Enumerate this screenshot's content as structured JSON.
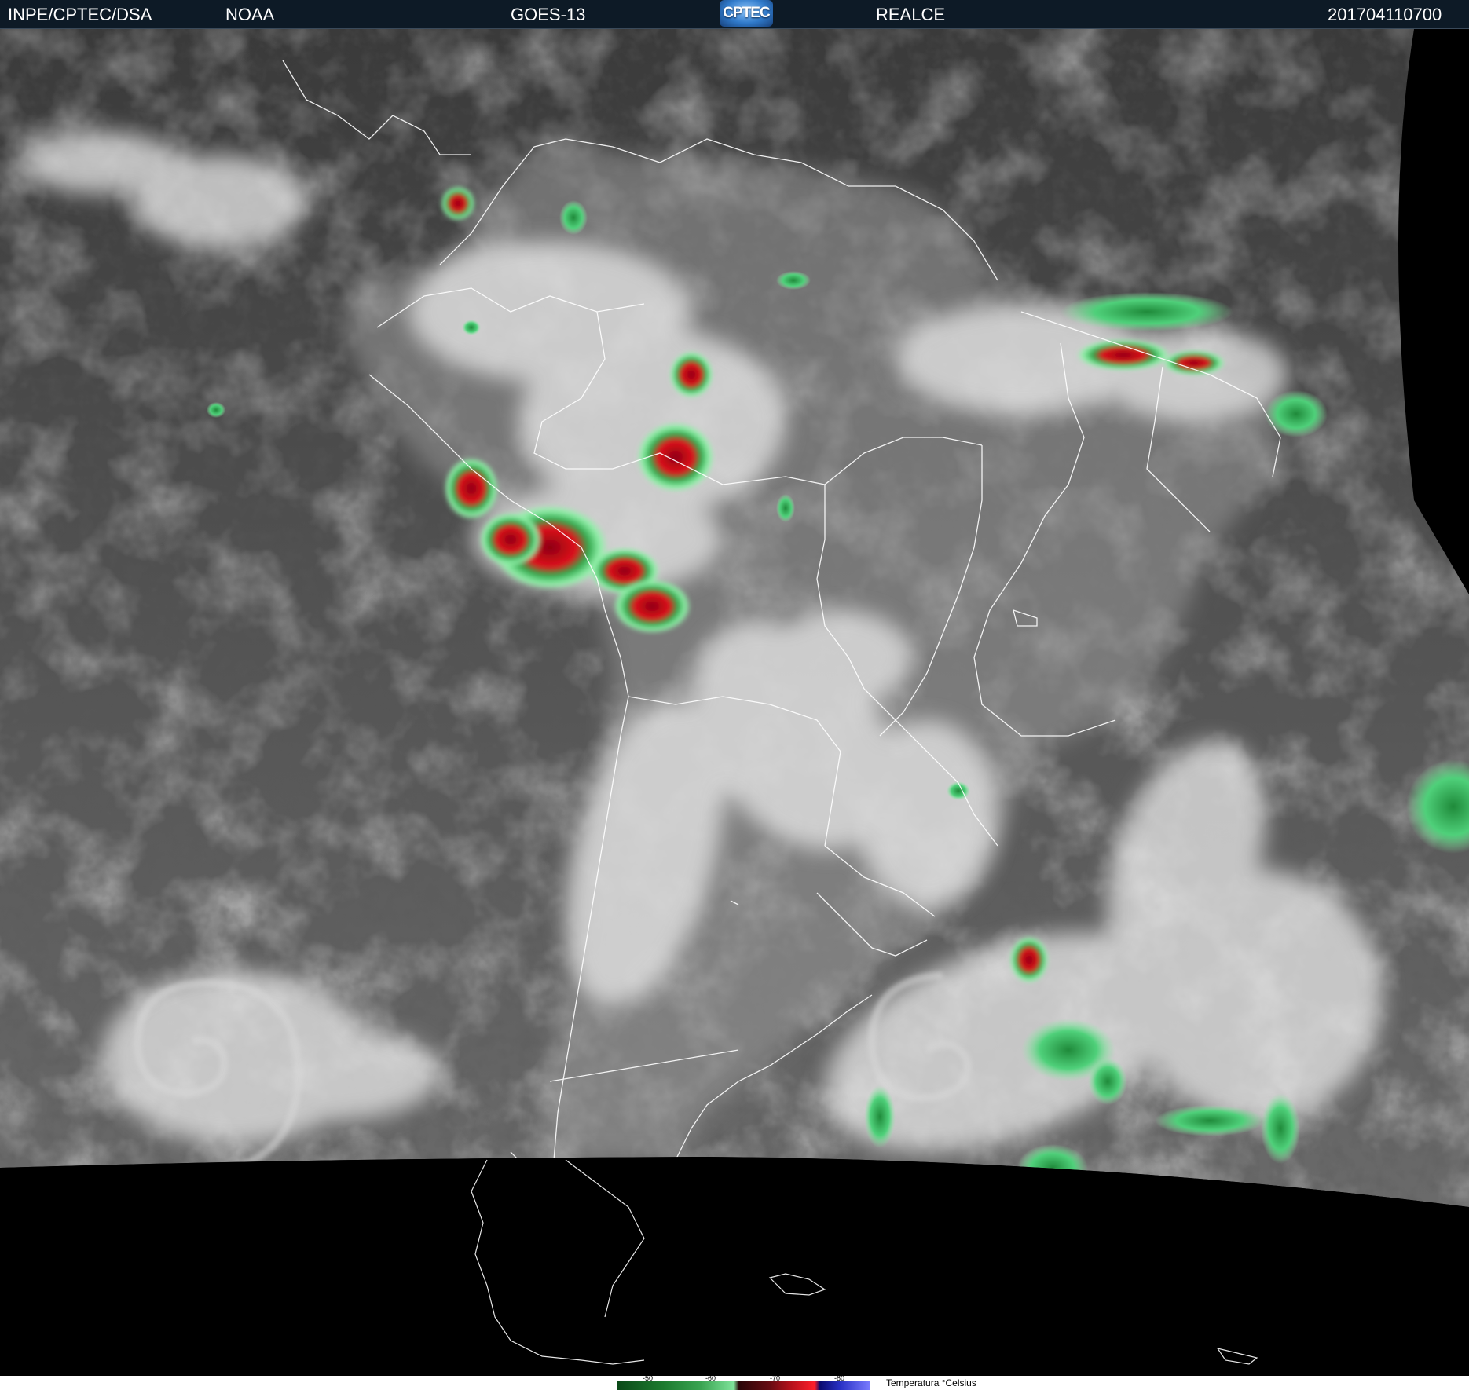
{
  "header": {
    "org": "INPE/CPTEC/DSA",
    "agency": "NOAA",
    "satellite": "GOES-13",
    "logo_text": "CPTEC",
    "product": "REALCE",
    "timestamp": "201704110700"
  },
  "legend": {
    "ticks": [
      "-50",
      "-60",
      "-70",
      "-80"
    ],
    "title": "Temperatura °Celsius"
  },
  "colors": {
    "header_bg": "#0d1a26",
    "space": "#000000",
    "ocean_gray": "#5a5a5a",
    "cloud_white": "#e6e6e6",
    "cold_green": "#3fcf6a",
    "coldest_red": "#d81020",
    "border_line": "#ffffff"
  }
}
